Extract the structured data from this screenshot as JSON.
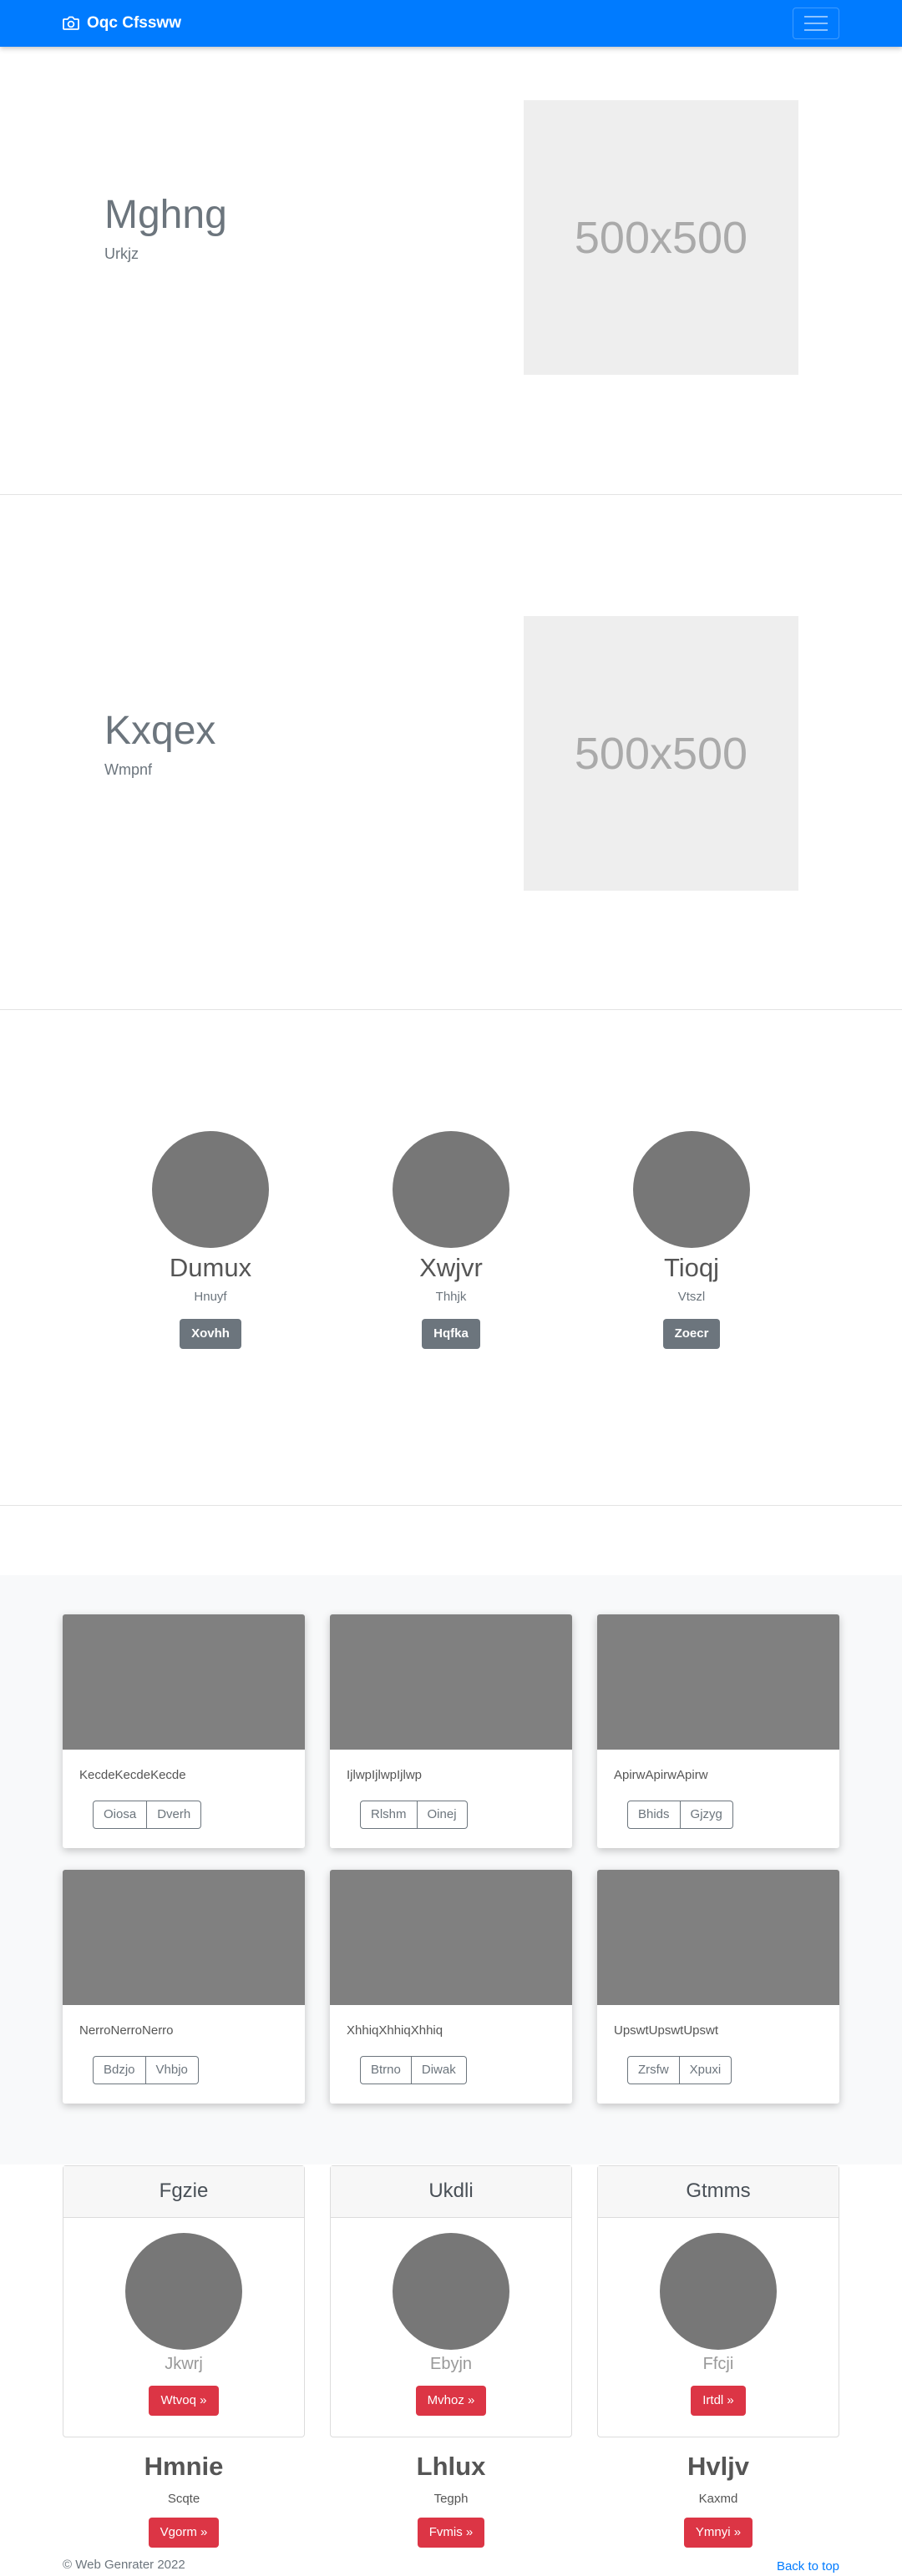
{
  "navbar": {
    "brand": "Oqc Cfssww"
  },
  "heroes": [
    {
      "title": "Mghng",
      "subtitle": "Urkjz",
      "image_label": "500x500"
    },
    {
      "title": "Kxqex",
      "subtitle": "Wmpnf",
      "image_label": "500x500"
    }
  ],
  "team": [
    {
      "name": "Dumux",
      "role": "Hnuyf",
      "button": "Xovhh"
    },
    {
      "name": "Xwjvr",
      "role": "Thhjk",
      "button": "Hqfka"
    },
    {
      "name": "Tioqj",
      "role": "Vtszl",
      "button": "Zoecr"
    }
  ],
  "album": [
    {
      "text": "KecdeKecdeKecde",
      "buttons": [
        "Oiosa",
        "Dverh"
      ]
    },
    {
      "text": "IjlwpIjlwpIjlwp",
      "buttons": [
        "Rlshm",
        "Oinej"
      ]
    },
    {
      "text": "ApirwApirwApirw",
      "buttons": [
        "Bhids",
        "Gjzyg"
      ]
    },
    {
      "text": "NerroNerroNerro",
      "buttons": [
        "Bdzjo",
        "Vhbjo"
      ]
    },
    {
      "text": "XhhiqXhhiqXhhiq",
      "buttons": [
        "Btrno",
        "Diwak"
      ]
    },
    {
      "text": "UpswtUpswtUpswt",
      "buttons": [
        "Zrsfw",
        "Xpuxi"
      ]
    }
  ],
  "profiles": [
    {
      "header": "Fgzie",
      "subtitle": "Jkwrj",
      "button": "Wtvoq »"
    },
    {
      "header": "Ukdli",
      "subtitle": "Ebyjn",
      "button": "Mvhoz »"
    },
    {
      "header": "Gtmms",
      "subtitle": "Ffcji",
      "button": "Irtdl »"
    }
  ],
  "features": [
    {
      "title": "Hmnie",
      "subtitle": "Scqte",
      "button": "Vgorm »"
    },
    {
      "title": "Lhlux",
      "subtitle": "Tegph",
      "button": "Fvmis »"
    },
    {
      "title": "Hvljv",
      "subtitle": "Kaxmd",
      "button": "Ymnyi »"
    }
  ],
  "footer": {
    "copyright": "© Web Genrater 2022",
    "back_to_top": "Back to top"
  },
  "colors": {
    "primary": "#007bff",
    "secondary": "#6c757d",
    "danger": "#dc3545",
    "placeholder": "#eeeeee"
  },
  "icons": {
    "brand": "camera-icon",
    "toggler": "hamburger-icon"
  }
}
